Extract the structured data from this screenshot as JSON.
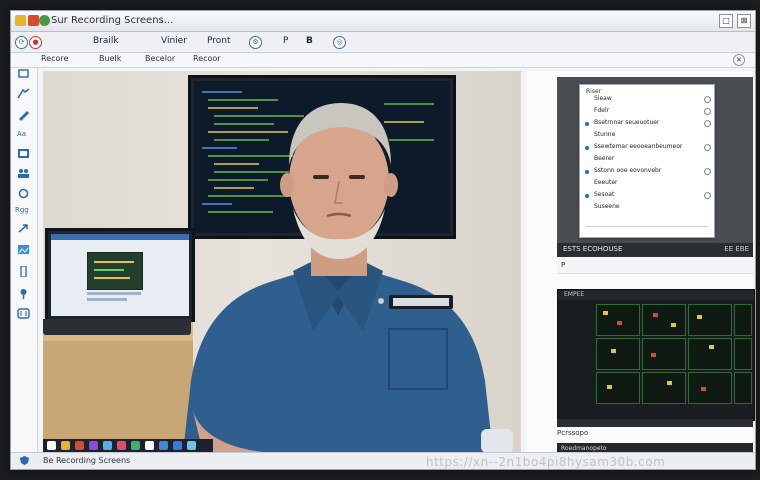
{
  "window": {
    "title": "Sur Recording Screens...",
    "minimize": "□",
    "close": "⊠"
  },
  "toolbar": {
    "items": [
      "Brailk",
      "Vinier",
      "Pront",
      "P",
      "B"
    ]
  },
  "menu": {
    "items": [
      "Recore",
      "Buelk",
      "Becelor",
      "Recoor"
    ]
  },
  "sidebar": {
    "label": "Rgg"
  },
  "status": {
    "text": "Be Recording Screens"
  },
  "dialog": {
    "title": "Riser",
    "rows": [
      "Sieaw",
      "Fdelr",
      "Bsetrnnar seueuotuer",
      "Stunne",
      "Ssewtemar eeooeanbeumeor",
      "Beerer",
      "Sstonn ooe eovonvebr",
      "Eeeuter",
      "Sesoat",
      "Suseene"
    ]
  },
  "right_panel": {
    "header_title": "ESTS ECOHOUSE",
    "header_value": "EE EBE",
    "sub_text": "P",
    "dark_title": "EMPEE",
    "lower_label": "Pcrssopo",
    "lower_strip_text": "Roedmanopeto"
  },
  "watermark": {
    "text": "https://xn--2n1bo4pi8hysam30b.com"
  },
  "colors": {
    "accent": "#2b5fa8",
    "shirt": "#2f5f8f",
    "monitor_code": "#5fb24c"
  }
}
